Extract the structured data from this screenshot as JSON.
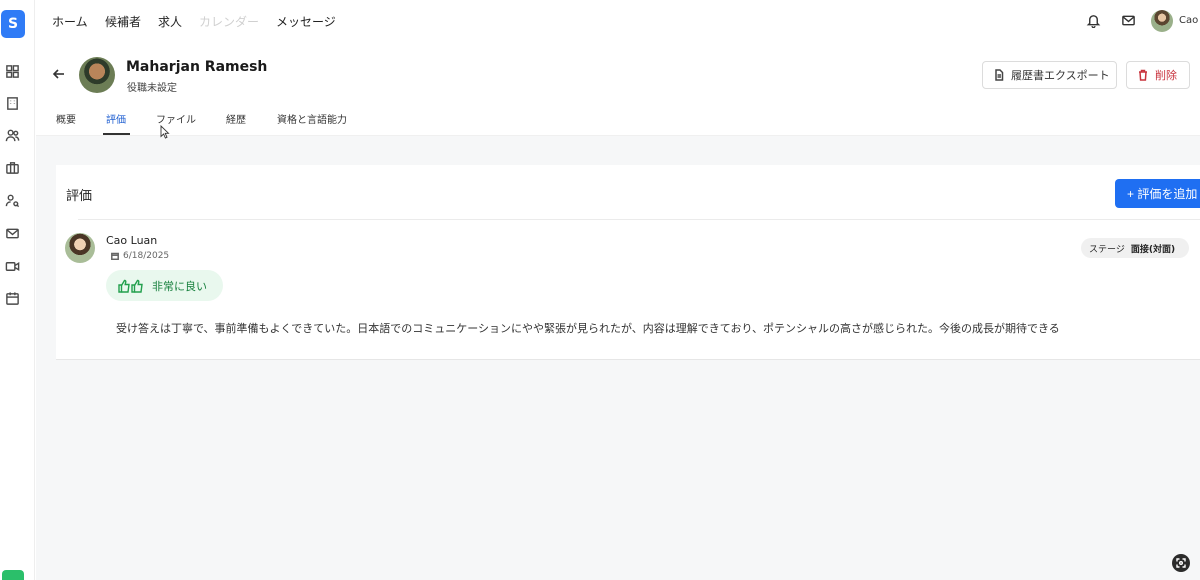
{
  "app": {
    "logo_letter": "S"
  },
  "topnav": {
    "items": [
      {
        "label": "ホーム"
      },
      {
        "label": "候補者"
      },
      {
        "label": "求人"
      },
      {
        "label": "カレンダー"
      },
      {
        "label": "メッセージ"
      }
    ],
    "user_name": "Cao"
  },
  "sidebar": {
    "icons": [
      "grid-icon",
      "building-icon",
      "users-icon",
      "briefcase-icon",
      "user-search-icon",
      "mail-icon",
      "video-icon",
      "calendar-icon"
    ]
  },
  "profile": {
    "name": "Maharjan Ramesh",
    "role": "役職未設定",
    "export_label": "履歴書エクスポート",
    "delete_label": "削除"
  },
  "tabs": [
    {
      "label": "概要"
    },
    {
      "label": "評価",
      "active": true
    },
    {
      "label": "ファイル"
    },
    {
      "label": "経歴"
    },
    {
      "label": "資格と言語能力"
    }
  ],
  "evaluation": {
    "section_title": "評価",
    "add_button_label": "+ 評価を追加",
    "entries": [
      {
        "author": "Cao Luan",
        "date": "6/18/2025",
        "rating": "非常に良い",
        "stage_label": "ステージ",
        "stage_value": "面接(対面)",
        "comment": "受け答えは丁寧で、事前準備もよくできていた。日本語でのコミュニケーションにやや緊張が見られたが、内容は理解できており、ポテンシャルの高さが感じられた。今後の成長が期待できる"
      }
    ]
  },
  "colors": {
    "accent": "#1f6ff2",
    "danger": "#c8323c",
    "positive": "#17803d"
  }
}
